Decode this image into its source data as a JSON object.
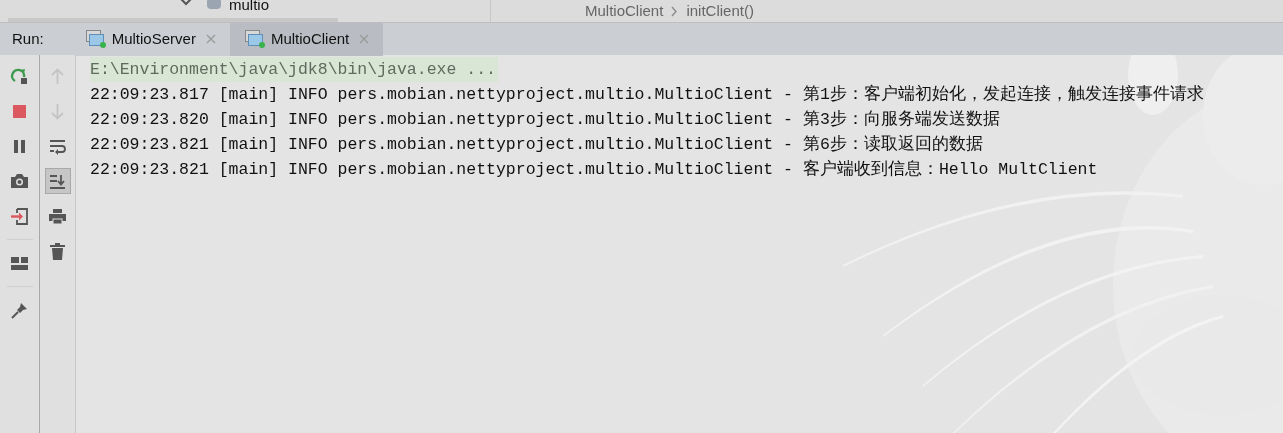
{
  "project_tree": {
    "item": "multio"
  },
  "breadcrumb": [
    "MultioClient",
    "initClient()"
  ],
  "run_panel": {
    "label": "Run:",
    "tabs": [
      {
        "label": "MultioServer",
        "selected": false
      },
      {
        "label": "MultioClient",
        "selected": true
      }
    ]
  },
  "run_toolbar": [
    {
      "kind": "rerun"
    },
    {
      "kind": "stop"
    },
    {
      "kind": "pause"
    },
    {
      "kind": "camera"
    },
    {
      "kind": "exit"
    },
    {
      "kind": "separator"
    },
    {
      "kind": "layout"
    },
    {
      "kind": "separator"
    },
    {
      "kind": "pin"
    }
  ],
  "console_toolbar": [
    {
      "kind": "up",
      "disabled": true
    },
    {
      "kind": "down",
      "disabled": true
    },
    {
      "kind": "wrap",
      "on": false
    },
    {
      "kind": "scroll-end",
      "on": true
    },
    {
      "kind": "print",
      "on": false
    },
    {
      "kind": "trash",
      "on": false
    }
  ],
  "console": {
    "command": "E:\\Environment\\java\\jdk8\\bin\\java.exe ...",
    "lines": [
      "22:09:23.817 [main] INFO pers.mobian.nettyproject.multio.MultioClient - 第1步：客户端初始化，发起连接，触发连接事件请求",
      "22:09:23.820 [main] INFO pers.mobian.nettyproject.multio.MultioClient - 第3步：向服务端发送数据",
      "22:09:23.821 [main] INFO pers.mobian.nettyproject.multio.MultioClient - 第6步：读取返回的数据",
      "22:09:23.821 [main] INFO pers.mobian.nettyproject.multio.MultioClient - 客户端收到信息：Hello MultClient"
    ]
  }
}
